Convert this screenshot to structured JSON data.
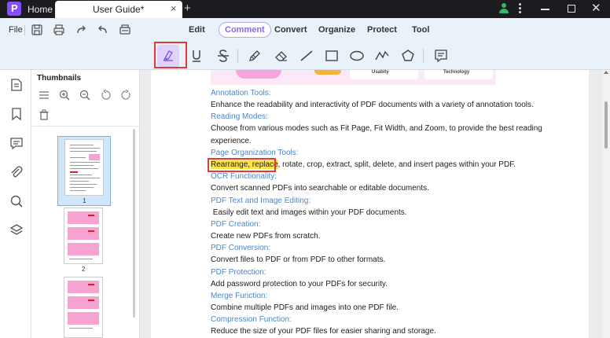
{
  "window": {
    "tab_home": "Home",
    "tab_title": "User Guide*",
    "tab_close": "×",
    "tab_add": "+"
  },
  "menu": {
    "file_label": "File",
    "items": [
      {
        "label": "Edit",
        "active": false
      },
      {
        "label": "Comment",
        "active": true
      },
      {
        "label": "Convert",
        "active": false
      },
      {
        "label": "Organize",
        "active": false
      },
      {
        "label": "Protect",
        "active": false
      },
      {
        "label": "Tool",
        "active": false
      }
    ]
  },
  "comment_tools": [
    {
      "name": "highlight-icon",
      "selected": true
    },
    {
      "name": "underline-icon",
      "selected": false
    },
    {
      "name": "strikethrough-icon",
      "selected": false
    },
    {
      "name": "pencil-icon",
      "selected": false
    },
    {
      "name": "eraser-icon",
      "selected": false
    },
    {
      "name": "line-icon",
      "selected": false
    },
    {
      "name": "rectangle-icon",
      "selected": false
    },
    {
      "name": "ellipse-icon",
      "selected": false
    },
    {
      "name": "polyline-icon",
      "selected": false
    },
    {
      "name": "polygon-icon",
      "selected": false
    },
    {
      "name": "note-icon",
      "selected": false
    }
  ],
  "thumbnails": {
    "title": "Thumbnails",
    "pages": [
      {
        "number": "1",
        "selected": true
      },
      {
        "number": "2",
        "selected": false
      },
      {
        "number": "",
        "selected": false
      }
    ]
  },
  "banner": {
    "card1": "Usabity",
    "card2": "Technology"
  },
  "document": {
    "sections": [
      {
        "heading": "Annotation Tools:",
        "body": [
          "Enhance the readability and interactivity of PDF documents with a variety of annotation tools."
        ]
      },
      {
        "heading": "Reading Modes:",
        "body": [
          "Choose from various modes such as Fit Page, Fit Width, and Zoom, to provide the best reading",
          "experience."
        ]
      },
      {
        "heading": "Page Organization Tools:",
        "highlight": "Rearrange, replace",
        "body_after_highlight": ", rotate, crop, extract, split, delete, and insert pages within your PDF."
      },
      {
        "heading": "OCR Functionality:",
        "body": [
          "Convert scanned PDFs into searchable or editable documents."
        ]
      },
      {
        "heading": "PDF Text and Image Editing:",
        "body": [
          " Easily edit text and images within your PDF documents."
        ]
      },
      {
        "heading": "PDF Creation:",
        "body": [
          "Create new PDFs from scratch."
        ]
      },
      {
        "heading": "PDF Conversion:",
        "body": [
          "Convert files to PDF or from PDF to other formats."
        ]
      },
      {
        "heading": "PDF Protection:",
        "body": [
          "Add password protection to your PDFs for security."
        ]
      },
      {
        "heading": "Merge Function:",
        "body": [
          "Combine multiple PDFs and images into one PDF file."
        ]
      },
      {
        "heading": "Compression Function:",
        "body": [
          "Reduce the size of your PDF files for easier sharing and storage."
        ]
      }
    ]
  },
  "colors": {
    "accent": "#8b67e8",
    "heading_blue": "#4a86c8",
    "highlight_yellow": "#ffe24a",
    "annotation_red": "#e53935",
    "titlebar": "#1b1c20",
    "toolbar_bg": "#e9f1f9"
  }
}
